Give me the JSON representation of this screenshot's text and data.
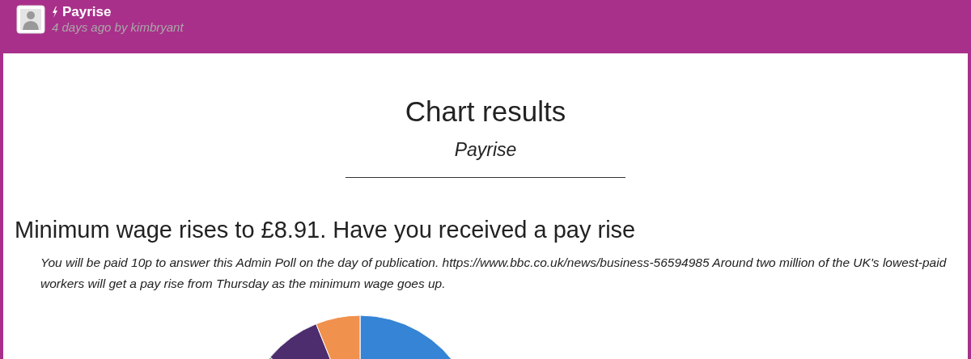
{
  "header": {
    "title": "Payrise",
    "byline": "4 days ago by kimbryant"
  },
  "page": {
    "title": "Chart results",
    "subtitle": "Payrise"
  },
  "question": {
    "title": "Minimum wage rises to £8.91. Have you received a pay rise",
    "description": "You will be paid 10p to answer this Admin Poll on the day of publication. https://www.bbc.co.uk/news/business-56594985 Around two million of the UK's lowest-paid workers will get a pay rise from Thursday as the minimum wage goes up."
  }
}
